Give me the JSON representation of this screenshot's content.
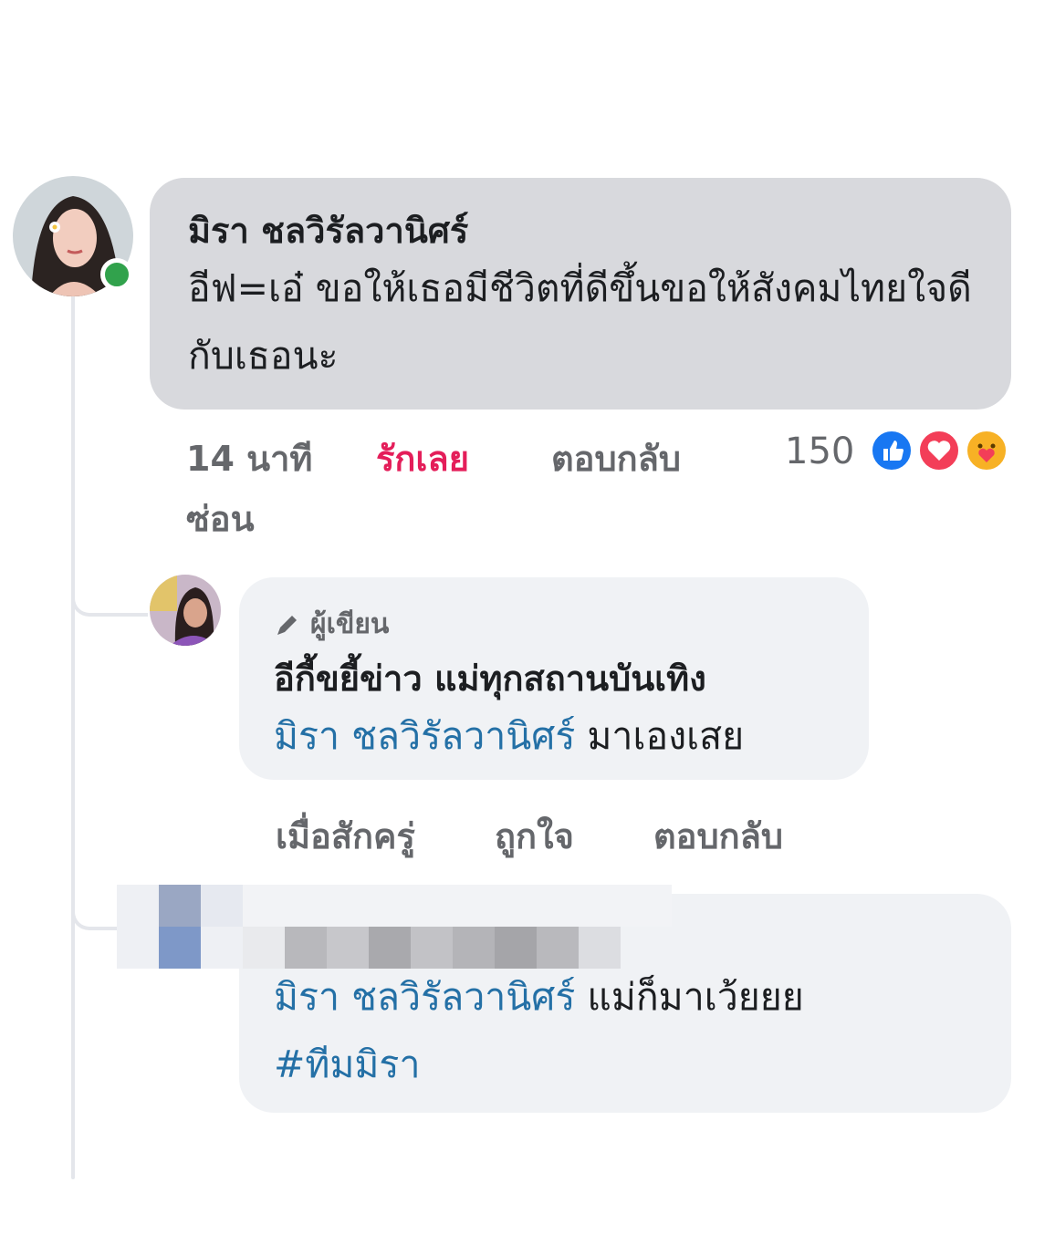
{
  "comment": {
    "author": "มิรา ชลวิรัลวานิศร์",
    "text": "อีฟ=เอ๋ ขอให้เธอมีชีวิตที่ดีขึ้นขอให้สังคมไทยใจดีกับเธอนะ",
    "time": "14 นาที",
    "love_label": "รักเลย",
    "reply_label": "ตอบกลับ",
    "reaction_count": "150",
    "hide_label": "ซ่อน",
    "reactions": [
      "like-icon",
      "love-icon",
      "care-icon"
    ]
  },
  "reply1": {
    "badge": "ผู้เขียน",
    "author": "อีกี้ขยี้ข่าว แม่ทุกสถานบันเทิง",
    "mention": "มิรา ชลวิรัลวานิศร์",
    "text": "มาเองเสย",
    "time": "เมื่อสักครู่",
    "like_label": "ถูกใจ",
    "reply_label": "ตอบกลับ"
  },
  "reply2": {
    "mention": "มิรา ชลวิรัลวานิศร์",
    "text": "แม่ก็มาเว้ยยย",
    "hashtag": "#ทีมมิรา"
  },
  "colors": {
    "link": "#2470a6",
    "love": "#e41e5a",
    "online": "#31a24c",
    "main_bubble": "#d8d9dd",
    "reply_bubble": "#f0f2f5"
  }
}
